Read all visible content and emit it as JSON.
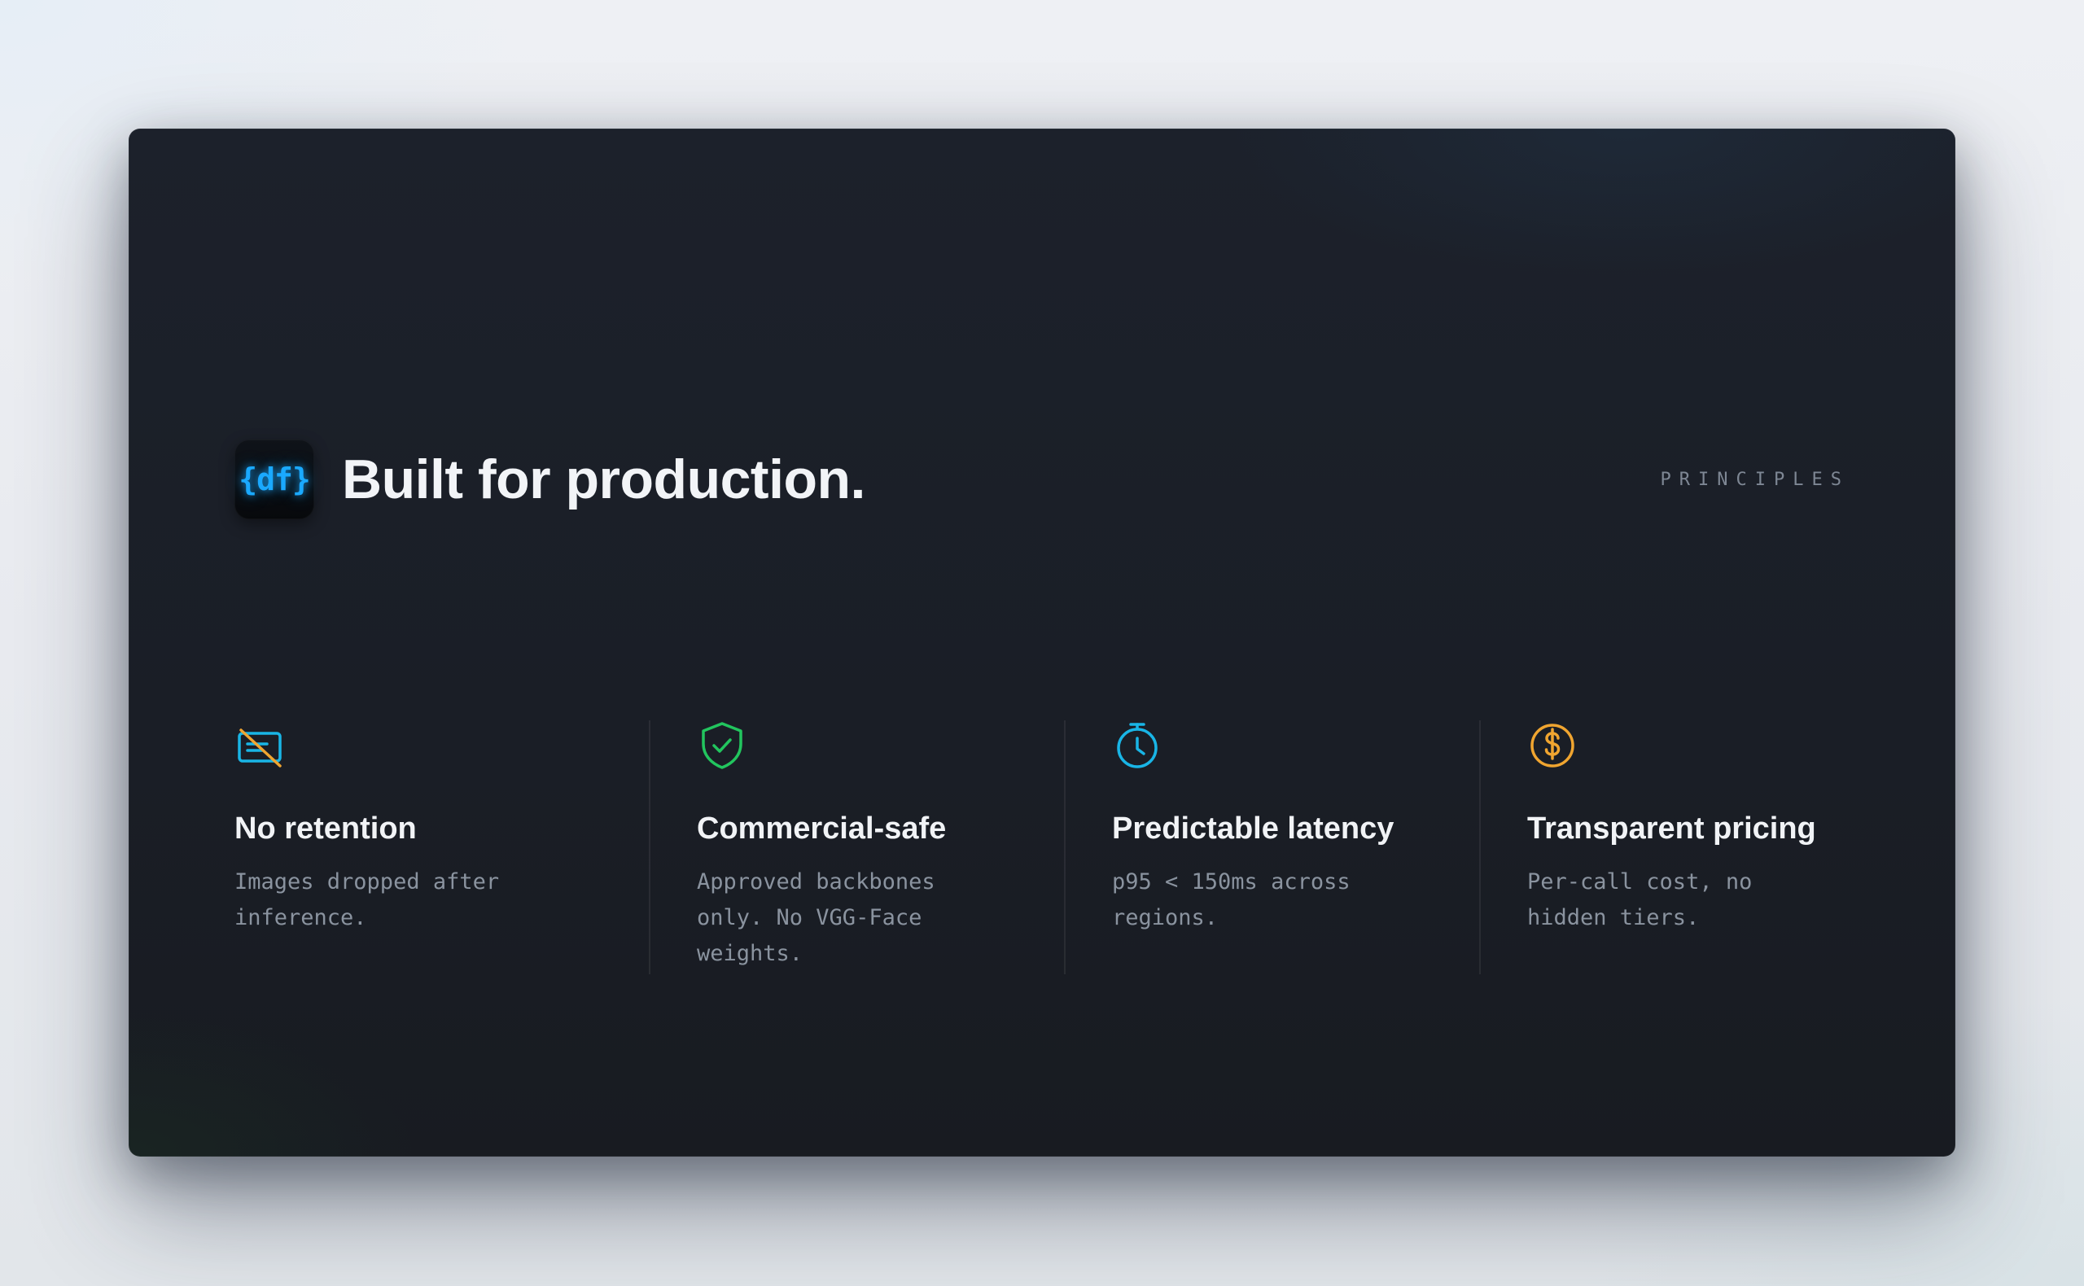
{
  "header": {
    "logo_text": "{df}",
    "title": "Built for production.",
    "eyebrow": "PRINCIPLES"
  },
  "features": [
    {
      "icon": "no-retention-icon",
      "title": "No retention",
      "description": "Images dropped after inference."
    },
    {
      "icon": "shield-check-icon",
      "title": "Commercial-safe",
      "description": "Approved backbones only. No VGG-Face weights."
    },
    {
      "icon": "stopwatch-icon",
      "title": "Predictable latency",
      "description": "p95 < 150ms across regions."
    },
    {
      "icon": "dollar-coin-icon",
      "title": "Transparent pricing",
      "description": "Per-call cost, no hidden tiers."
    }
  ],
  "colors": {
    "logo_glow": "#1aa9ff",
    "no_retention_icon": "#19b5e6",
    "no_retention_slash": "#f0a530",
    "shield_icon": "#22c55e",
    "stopwatch_icon": "#19b5e6",
    "dollar_icon": "#f0a530"
  }
}
